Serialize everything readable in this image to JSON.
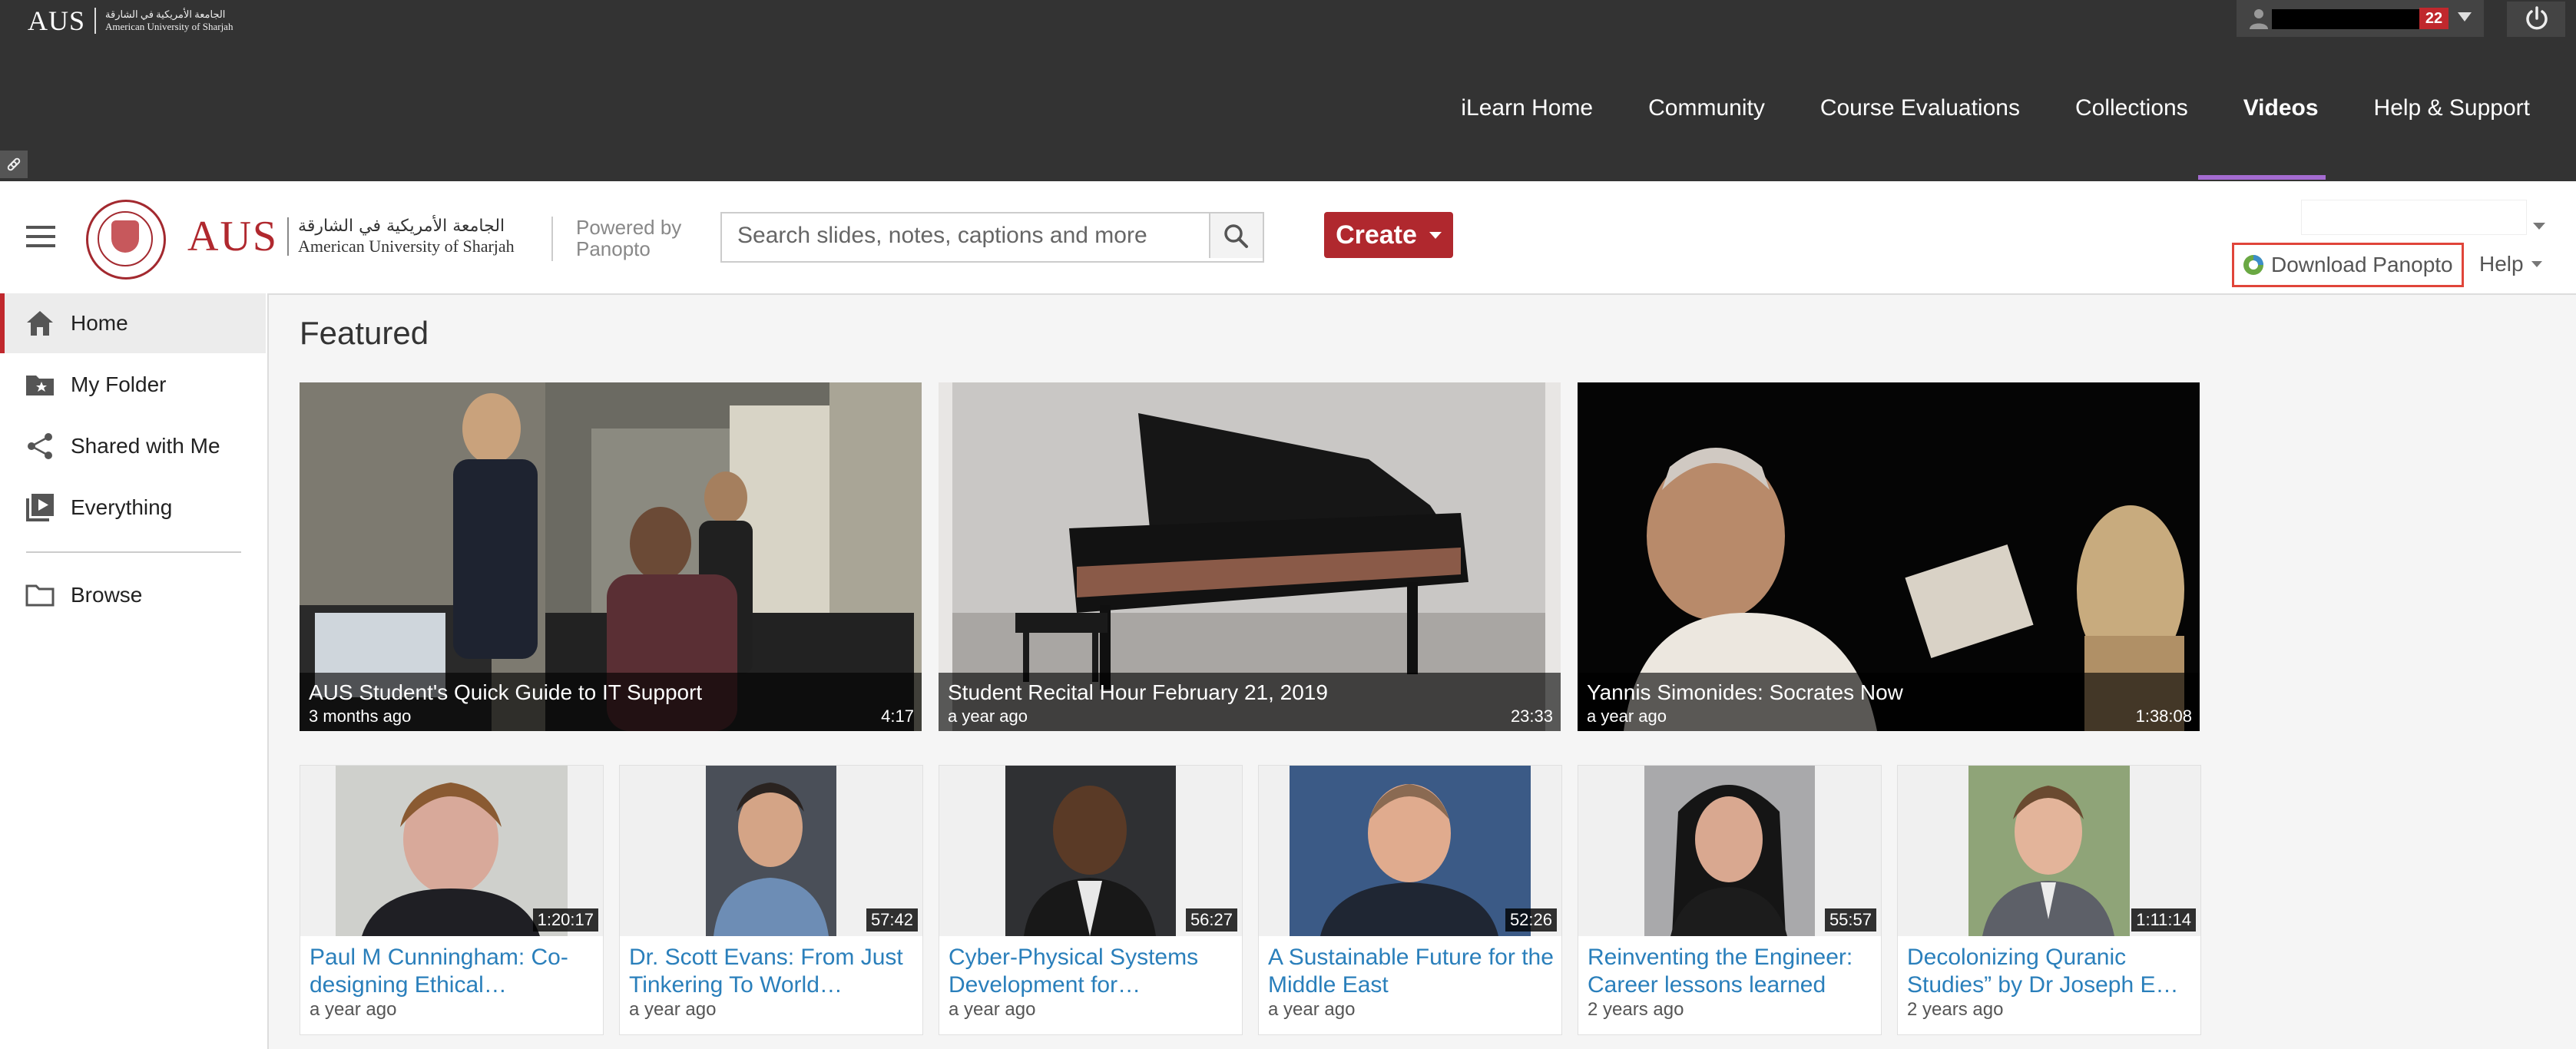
{
  "topbar": {
    "logo_aus": "AUS",
    "logo_arabic": "الجامعة الأمريكية في الشارقة",
    "logo_english": "American University of Sharjah",
    "notification_count": "22",
    "nav": [
      "iLearn Home",
      "Community",
      "Course Evaluations",
      "Collections",
      "Videos",
      "Help & Support"
    ],
    "active_nav": "Videos",
    "accent_color": "#a46bd1"
  },
  "header": {
    "brand_aus": "AUS",
    "brand_arabic": "الجامعة الأمريكية في الشارقة",
    "brand_english": "American University of Sharjah",
    "powered_line1": "Powered by",
    "powered_line2": "Panopto",
    "search_placeholder": "Search slides, notes, captions and more",
    "create_label": "Create",
    "download_label": "Download Panopto",
    "help_label": "Help",
    "brand_color": "#b0282e"
  },
  "sidebar": {
    "items": [
      {
        "label": "Home",
        "icon": "home-icon",
        "active": true
      },
      {
        "label": "My Folder",
        "icon": "folder-star-icon"
      },
      {
        "label": "Shared with Me",
        "icon": "share-icon"
      },
      {
        "label": "Everything",
        "icon": "video-library-icon"
      },
      {
        "label": "Browse",
        "icon": "folder-icon"
      }
    ]
  },
  "main": {
    "section_title": "Featured",
    "featured": [
      {
        "title": "AUS Student's Quick Guide to IT Support",
        "age": "3 months ago",
        "duration": "4:17"
      },
      {
        "title": "Student Recital Hour February 21, 2019",
        "age": "a year ago",
        "duration": "23:33"
      },
      {
        "title": "Yannis Simonides: Socrates Now",
        "age": "a year ago",
        "duration": "1:38:08"
      }
    ],
    "videos": [
      {
        "title": "Paul M Cunningham: Co-designing Ethical…",
        "age": "a year ago",
        "duration": "1:20:17"
      },
      {
        "title": "Dr. Scott Evans: From Just Tinkering To World…",
        "age": "a year ago",
        "duration": "57:42"
      },
      {
        "title": "Cyber-Physical Systems Development for…",
        "age": "a year ago",
        "duration": "56:27"
      },
      {
        "title": "A Sustainable Future for the Middle East",
        "age": "a year ago",
        "duration": "52:26"
      },
      {
        "title": "Reinventing the Engineer: Career lessons learned",
        "age": "2 years ago",
        "duration": "55:57"
      },
      {
        "title": "Decolonizing Quranic Studies” by Dr Joseph E…",
        "age": "2 years ago",
        "duration": "1:11:14"
      }
    ]
  }
}
